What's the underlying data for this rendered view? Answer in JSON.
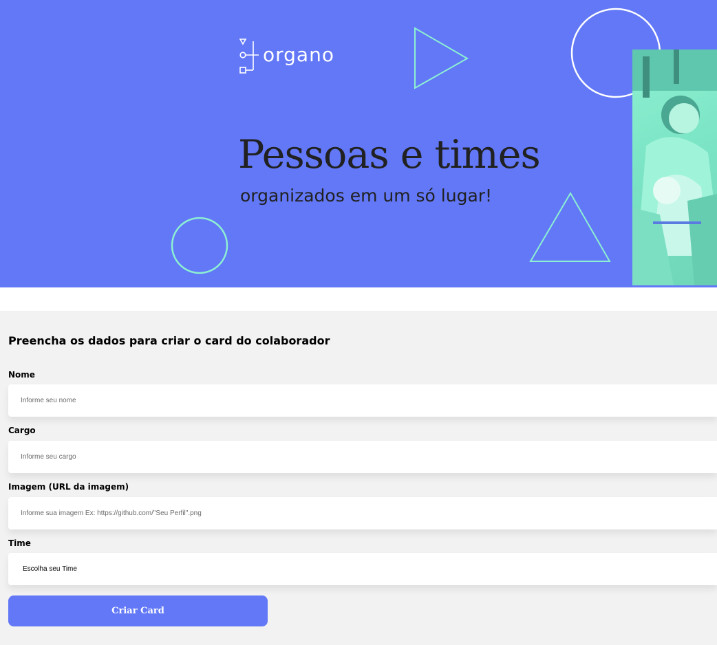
{
  "banner": {
    "logo_text": "organo",
    "title": "Pessoas e times",
    "subtitle": "organizados em um só lugar!",
    "background_color": "#6278F7",
    "accent_color": "#8DF0D2"
  },
  "form": {
    "title": "Preencha os dados para criar o card do colaborador",
    "fields": [
      {
        "label": "Nome",
        "placeholder": "Informe seu nome"
      },
      {
        "label": "Cargo",
        "placeholder": "Informe seu cargo"
      },
      {
        "label": "Imagem (URL da imagem)",
        "placeholder": "Informe sua imagem Ex: https://github.com/\"Seu Perfil\".png"
      }
    ],
    "team": {
      "label": "Time",
      "selected": "Escolha seu Time"
    },
    "submit_label": "Criar Card"
  }
}
